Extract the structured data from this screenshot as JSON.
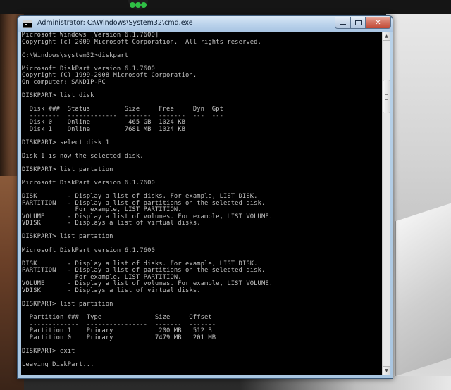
{
  "window": {
    "title": "Administrator: C:\\Windows\\System32\\cmd.exe",
    "min_symbol": "",
    "max_symbol": "",
    "close_symbol": "✕"
  },
  "console": {
    "lines": [
      "Microsoft Windows [Version 6.1.7600]",
      "Copyright (c) 2009 Microsoft Corporation.  All rights reserved.",
      "",
      "C:\\Windows\\system32>diskpart",
      "",
      "Microsoft DiskPart version 6.1.7600",
      "Copyright (C) 1999-2008 Microsoft Corporation.",
      "On computer: SANDIP-PC",
      "",
      "DISKPART> list disk",
      "",
      "  Disk ###  Status         Size     Free     Dyn  Gpt",
      "  --------  -------------  -------  -------  ---  ---",
      "  Disk 0    Online          465 GB  1024 KB",
      "  Disk 1    Online         7681 MB  1024 KB",
      "",
      "DISKPART> select disk 1",
      "",
      "Disk 1 is now the selected disk.",
      "",
      "DISKPART> list partation",
      "",
      "Microsoft DiskPart version 6.1.7600",
      "",
      "DISK        - Display a list of disks. For example, LIST DISK.",
      "PARTITION   - Display a list of partitions on the selected disk.",
      "              For example, LIST PARTITION.",
      "VOLUME      - Display a list of volumes. For example, LIST VOLUME.",
      "VDISK       - Displays a list of virtual disks.",
      "",
      "DISKPART> list partation",
      "",
      "Microsoft DiskPart version 6.1.7600",
      "",
      "DISK        - Display a list of disks. For example, LIST DISK.",
      "PARTITION   - Display a list of partitions on the selected disk.",
      "              For example, LIST PARTITION.",
      "VOLUME      - Display a list of volumes. For example, LIST VOLUME.",
      "VDISK       - Displays a list of virtual disks.",
      "",
      "DISKPART> list partition",
      "",
      "  Partition ###  Type              Size     Offset",
      "  -------------  ----------------  -------  -------",
      "  Partition 1    Primary            200 MB   512 B",
      "  Partition 0    Primary           7479 MB   201 MB",
      "",
      "DISKPART> exit",
      "",
      "Leaving DiskPart..."
    ]
  },
  "scrollbar": {
    "up_arrow": "▲",
    "down_arrow": "▼"
  },
  "colors": {
    "console_bg": "#000000",
    "console_fg": "#c0c0c0",
    "titlebar": "#bcd4ec",
    "close_button": "#c24a36"
  }
}
